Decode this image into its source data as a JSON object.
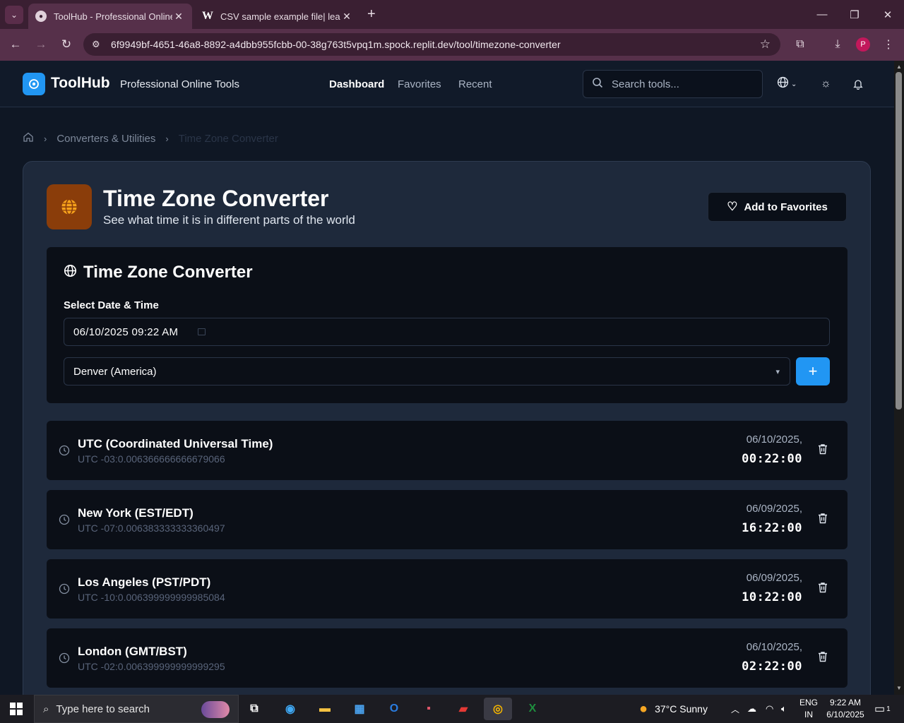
{
  "browser": {
    "active_tab_title": "ToolHub - Professional Online T",
    "inactive_tab_title": "CSV sample example file| learn",
    "inactive_tab_favicon": "W",
    "url": "6f9949bf-4651-46a8-8892-a4dbb955fcbb-00-38g763t5vpq1m.spock.replit.dev/tool/timezone-converter",
    "profile_initial": "P"
  },
  "header": {
    "brand": "ToolHub",
    "tagline": "Professional Online Tools",
    "nav": [
      "Dashboard",
      "Favorites",
      "Recent"
    ],
    "search_placeholder": "Search tools..."
  },
  "breadcrumb": {
    "section": "Converters & Utilities",
    "current": "Time Zone Converter"
  },
  "tool": {
    "title": "Time Zone Converter",
    "subtitle": "See what time it is in different parts of the world",
    "favorite_label": "Add to Favorites"
  },
  "converter": {
    "title": "Time Zone Converter",
    "date_label": "Select Date & Time",
    "date_value": "06/10/2025 09:22  AM",
    "selected_zone": "Denver (America)",
    "add_label": "+"
  },
  "zones": [
    {
      "name": "UTC (Coordinated Universal Time)",
      "offset": "UTC -03:0.006366666666679066",
      "date": "06/10/2025,",
      "time": "00:22:00"
    },
    {
      "name": "New York (EST/EDT)",
      "offset": "UTC -07:0.006383333333360497",
      "date": "06/09/2025,",
      "time": "16:22:00"
    },
    {
      "name": "Los Angeles (PST/PDT)",
      "offset": "UTC -10:0.006399999999985084",
      "date": "06/09/2025,",
      "time": "10:22:00"
    },
    {
      "name": "London (GMT/BST)",
      "offset": "UTC -02:0.006399999999999295",
      "date": "06/10/2025,",
      "time": "02:22:00"
    }
  ],
  "taskbar": {
    "search_placeholder": "Type here to search",
    "weather": "37°C  Sunny",
    "language_top": "ENG",
    "language_bottom": "IN",
    "time": "9:22 AM",
    "date": "6/10/2025",
    "notification_count": "1"
  },
  "colors": {
    "accent": "#2196f3",
    "tool_icon_bg": "#8a3d0a",
    "panel_bg": "#1e293b",
    "card_bg": "#0b0f17",
    "browser_frame": "#56304a"
  }
}
